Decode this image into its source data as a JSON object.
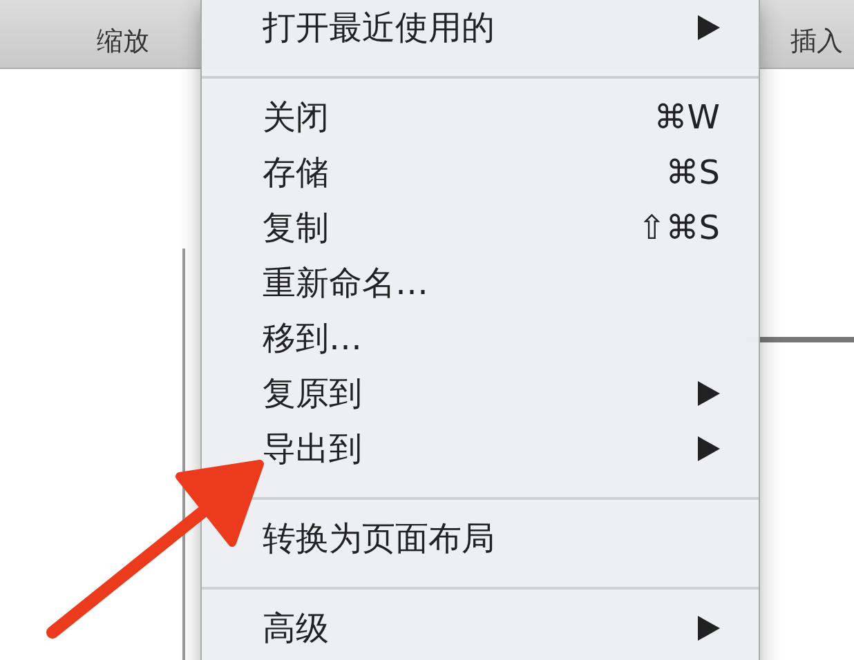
{
  "toolbar": {
    "buttons": [
      {
        "label": "缩放"
      },
      {
        "label": "插入"
      }
    ]
  },
  "menu": {
    "items": [
      {
        "kind": "item",
        "label": "打开最近使用的",
        "submenu": true
      },
      {
        "kind": "separator"
      },
      {
        "kind": "item",
        "label": "关闭",
        "shortcut": "⌘W"
      },
      {
        "kind": "item",
        "label": "存储",
        "shortcut": "⌘S"
      },
      {
        "kind": "item",
        "label": "复制",
        "shortcut": "⇧⌘S"
      },
      {
        "kind": "item",
        "label": "重新命名…"
      },
      {
        "kind": "item",
        "label": "移到…"
      },
      {
        "kind": "item",
        "label": "复原到",
        "submenu": true
      },
      {
        "kind": "item",
        "label": "导出到",
        "submenu": true
      },
      {
        "kind": "separator"
      },
      {
        "kind": "item",
        "label": "转换为页面布局"
      },
      {
        "kind": "separator"
      },
      {
        "kind": "item",
        "label": "高级",
        "submenu": true
      }
    ]
  },
  "annotation": {
    "kind": "arrow"
  }
}
